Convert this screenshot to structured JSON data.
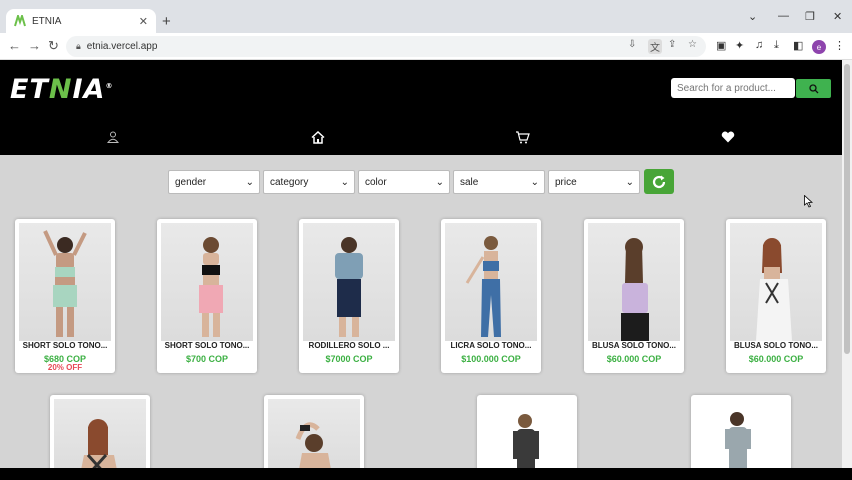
{
  "browser": {
    "tab_title": "ETNIA",
    "tab_close": "✕",
    "new_tab": "+",
    "url": "etnia.vercel.app",
    "profile_initial": "e"
  },
  "header": {
    "logo_prefix": "ET",
    "logo_n": "N",
    "logo_suffix": "IA",
    "logo_mark": "®",
    "search_placeholder": "Search for a product..."
  },
  "filters": [
    {
      "label": "gender"
    },
    {
      "label": "category"
    },
    {
      "label": "color"
    },
    {
      "label": "sale"
    },
    {
      "label": "price"
    }
  ],
  "products": [
    {
      "name": "SHORT SOLO TONO...",
      "price": "$680 COP",
      "sale": "20% OFF"
    },
    {
      "name": "SHORT SOLO TONO...",
      "price": "$700 COP",
      "sale": ""
    },
    {
      "name": "RODILLERO SOLO ...",
      "price": "$7000 COP",
      "sale": ""
    },
    {
      "name": "LICRA SOLO TONO...",
      "price": "$100.000 COP",
      "sale": ""
    },
    {
      "name": "BLUSA SOLO TONO...",
      "price": "$60.000 COP",
      "sale": ""
    },
    {
      "name": "BLUSA SOLO TONO...",
      "price": "$60.000 COP",
      "sale": ""
    }
  ],
  "colors": {
    "brand_green": "#6cc04a",
    "price_green": "#3cb043",
    "sale_red": "#e84855",
    "header_bg": "#000000"
  },
  "icons": [
    "user-icon",
    "home-icon",
    "cart-icon",
    "heart-icon",
    "search-icon",
    "refresh-icon"
  ]
}
